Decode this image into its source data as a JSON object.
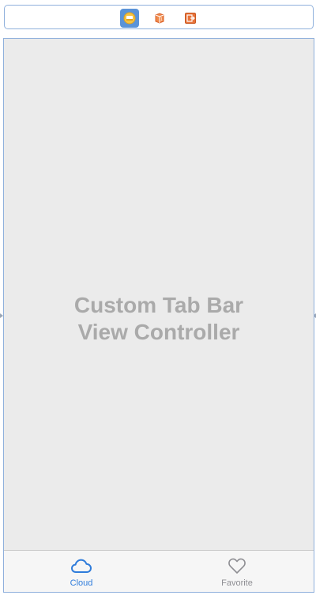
{
  "scene_dock": {
    "icons": [
      {
        "name": "view-controller-icon",
        "selected": true
      },
      {
        "name": "first-responder-icon",
        "selected": false
      },
      {
        "name": "exit-icon",
        "selected": false
      }
    ]
  },
  "canvas": {
    "title_line1": "Custom Tab Bar",
    "title_line2": "View Controller"
  },
  "tab_bar": {
    "items": [
      {
        "label": "Cloud",
        "icon": "cloud-icon",
        "selected": true
      },
      {
        "label": "Favorite",
        "icon": "heart-icon",
        "selected": false
      }
    ],
    "selected_color": "#2f7cdb",
    "unselected_color": "#8e8e93"
  }
}
